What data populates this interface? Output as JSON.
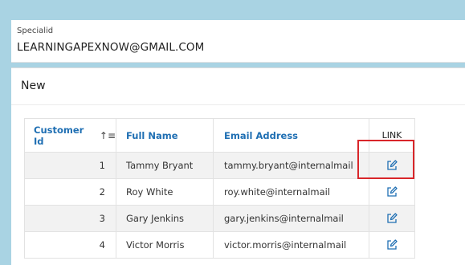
{
  "page_item": {
    "label": "Specialid",
    "value": "LEARNINGAPEXNOW@GMAIL.COM"
  },
  "region": {
    "title": "New"
  },
  "report": {
    "columns": {
      "customer_id": "Customer Id",
      "full_name": "Full Name",
      "email": "Email Address",
      "link": "LINK"
    },
    "sort_icon": "sort-ascending-icon",
    "link_icon": "edit-icon",
    "rows": [
      {
        "id": "1",
        "name": "Tammy Bryant",
        "email": "tammy.bryant@internalmail"
      },
      {
        "id": "2",
        "name": "Roy White",
        "email": "roy.white@internalmail"
      },
      {
        "id": "3",
        "name": "Gary Jenkins",
        "email": "gary.jenkins@internalmail"
      },
      {
        "id": "4",
        "name": "Victor Morris",
        "email": "victor.morris@internalmail"
      }
    ]
  },
  "colors": {
    "page_background": "#a9d3e3",
    "header_link": "#1f6fb3",
    "highlight_box": "#d9262a"
  }
}
